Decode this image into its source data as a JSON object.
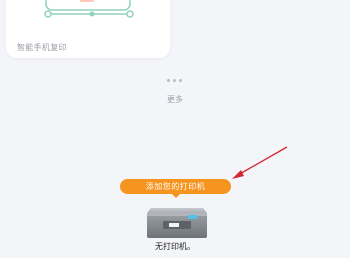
{
  "card": {
    "label": "智能手机复印",
    "icon": "phone-copy-icon"
  },
  "more": {
    "label": "更多",
    "icon": "more-dots-icon"
  },
  "add_printer": {
    "label": "添加您的打印机",
    "color": "#f5941f"
  },
  "printer": {
    "icon": "printer-icon",
    "status": "无打印机。"
  },
  "annotation": {
    "icon": "red-arrow-icon",
    "color": "#d0282e"
  }
}
